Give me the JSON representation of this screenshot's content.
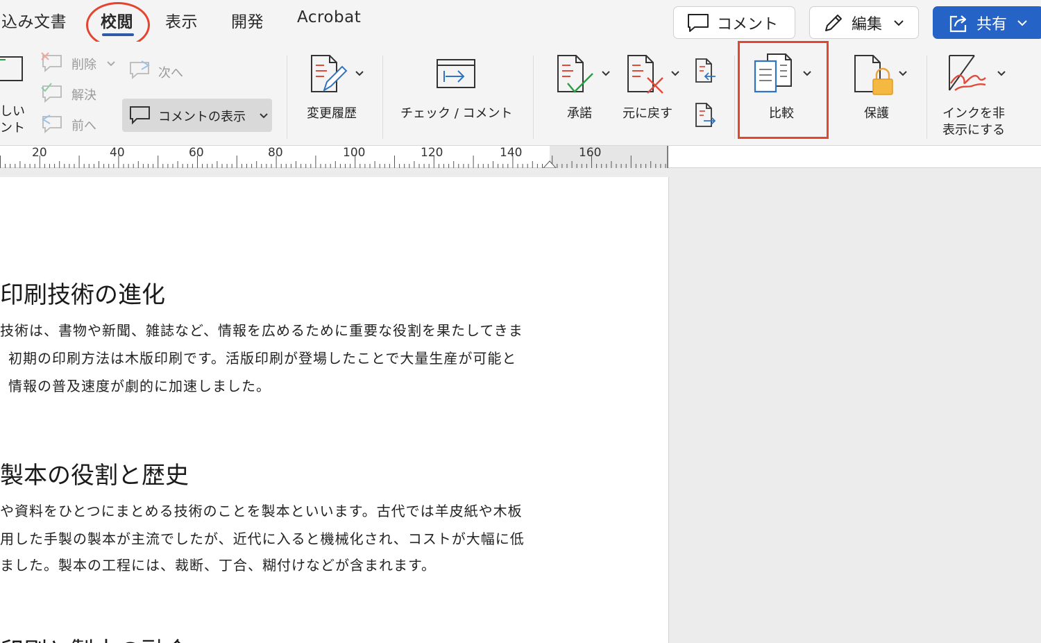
{
  "tabs": [
    {
      "label": "込み文書"
    },
    {
      "label": "校閲",
      "active": true
    },
    {
      "label": "表示"
    },
    {
      "label": "開発"
    },
    {
      "label": "Acrobat"
    }
  ],
  "top_actions": {
    "comment_label": "コメント",
    "edit_label": "編集",
    "share_label": "共有"
  },
  "ribbon": {
    "new_comment_line1": "しい",
    "new_comment_line2": "ント",
    "delete_label": "削除",
    "resolve_label": "解決",
    "prev_label": "前へ",
    "next_label": "次へ",
    "show_comments_label": "コメントの表示",
    "track_changes_label": "変更履歴",
    "check_comment_label": "チェック / コメント",
    "accept_label": "承諾",
    "reject_label": "元に戻す",
    "compare_label": "比較",
    "protect_label": "保護",
    "hide_ink_line1": "インクを非",
    "hide_ink_line2": "表示にする"
  },
  "ruler": {
    "labels": [
      "20",
      "40",
      "60",
      "80",
      "100",
      "120",
      "140",
      "160"
    ]
  },
  "document": {
    "heading1": "印刷技術の進化",
    "para1_line1": "技術は、書物や新聞、雑誌など、情報を広めるために重要な役割を果たしてきま",
    "para1_line2": "初期の印刷方法は木版印刷です。活版印刷が登場したことで大量生産が可能と",
    "para1_line3": "情報の普及速度が劇的に加速しました。",
    "heading2": "製本の役割と歴史",
    "para2_line1": "や資料をひとつにまとめる技術のことを製本といいます。古代では羊皮紙や木板",
    "para2_line2": "用した手製の製本が主流でしたが、近代に入ると機械化され、コストが大幅に低",
    "para2_line3": "ました。製本の工程には、裁断、丁合、糊付けなどが含まれます。",
    "heading3": "印刷と製本の融合"
  },
  "colors": {
    "accent_blue": "#2563c7",
    "annotation_red": "#e4452f",
    "tab_underline": "#2e5aa8"
  }
}
